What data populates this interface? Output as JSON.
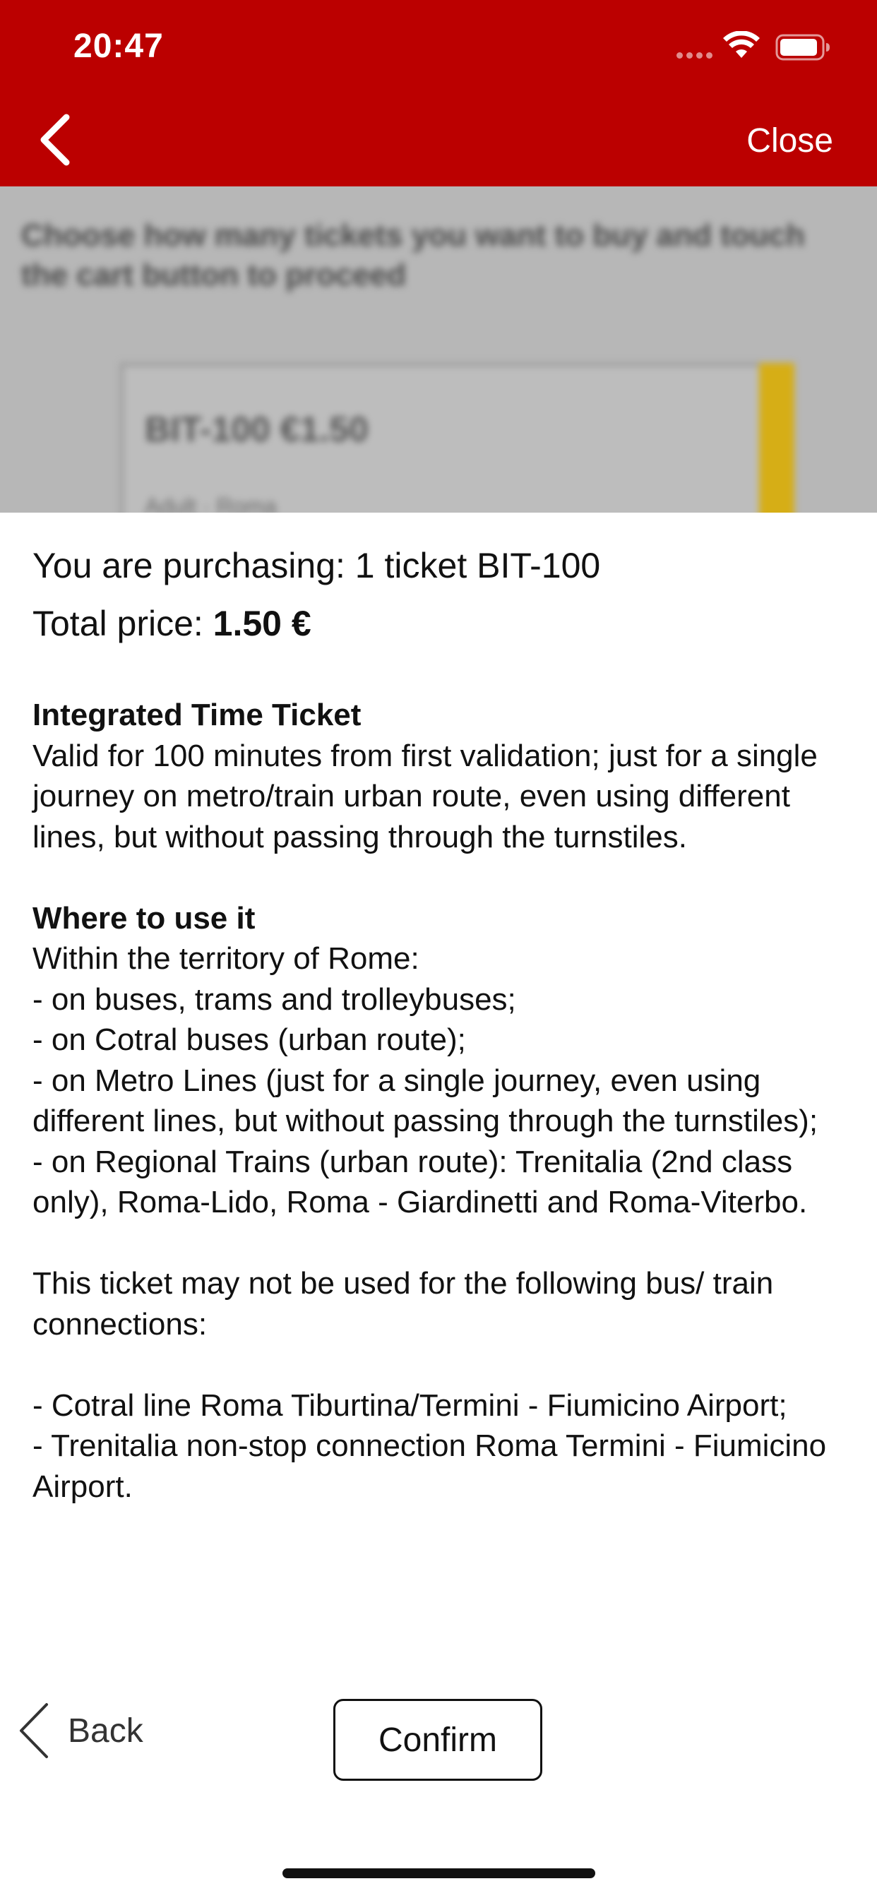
{
  "status_bar": {
    "time": "20:47"
  },
  "nav": {
    "close_label": "Close"
  },
  "background": {
    "instruction": "Choose how many tickets you want to buy and touch the cart button to proceed",
    "card_title": "BIT-100 €1.50",
    "card_sub": "Adult · Roma",
    "accent_color": "#d6ae16"
  },
  "summary": {
    "purchasing_text": "You are purchasing: 1 ticket BIT-100",
    "total_label": "Total price: ",
    "total_value": "1.50 €"
  },
  "details": {
    "ticket_heading": "Integrated Time Ticket",
    "ticket_desc": "Valid for 100 minutes from first validation; just for a single journey on metro/train urban route, even using different lines, but without passing through the turnstiles.",
    "where_heading": "Where to use it",
    "where_intro": "Within the territory of Rome:",
    "where_items": [
      "- on buses, trams and trolleybuses;",
      "- on Cotral buses (urban route);",
      "- on Metro Lines (just for a single journey, even using different lines, but without passing through the turnstiles);",
      "- on Regional Trains (urban route): Trenitalia (2nd class only), Roma-Lido, Roma - Giardinetti and Roma-Viterbo."
    ],
    "exclusion_intro": "This ticket may not be used for the following bus/ train connections:",
    "exclusion_items": [
      "- Cotral line Roma Tiburtina/Termini - Fiumicino Airport;",
      "- Trenitalia non-stop connection Roma Termini - Fiumicino Airport."
    ]
  },
  "actions": {
    "back_label": "Back",
    "confirm_label": "Confirm"
  },
  "colors": {
    "header": "#bb0000"
  }
}
